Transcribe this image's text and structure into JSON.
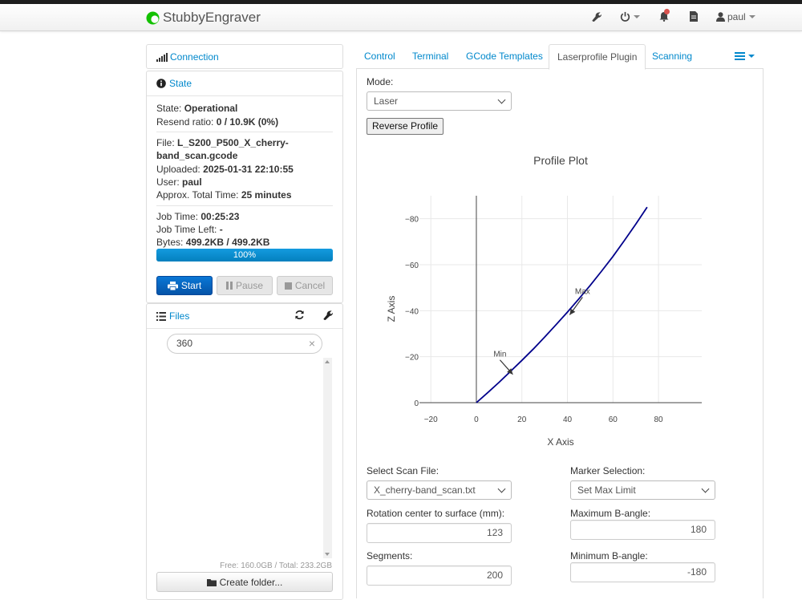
{
  "app": {
    "title": "StubbyEngraver",
    "user": "paul"
  },
  "sidebar": {
    "connection_label": "Connection",
    "state_label": "State",
    "state": {
      "state_key": "State:",
      "state_val": "Operational",
      "resend_key": "Resend ratio:",
      "resend_val": "0 / 10.9K (0%)",
      "file_key": "File:",
      "file_line1": "L_S200_P500_X_cherry-",
      "file_line2": "band_scan.gcode",
      "uploaded_key": "Uploaded:",
      "uploaded_val": "2025-01-31 22:10:55",
      "user_key": "User:",
      "user_val": "paul",
      "approx_key": "Approx. Total Time:",
      "approx_val": "25 minutes",
      "jobtime_key": "Job Time:",
      "jobtime_val": "00:25:23",
      "jobleft_key": "Job Time Left:",
      "jobleft_val": "-",
      "bytes_key": "Bytes:",
      "bytes_val": "499.2KB / 499.2KB",
      "progress_text": "100%",
      "progress_fraction": 1.0
    },
    "buttons": {
      "start": "Start",
      "pause": "Pause",
      "cancel": "Cancel"
    },
    "files": {
      "label": "Files",
      "search_value": "360",
      "free_text": "Free: 160.0GB / Total: 233.2GB",
      "create_folder": "Create folder..."
    }
  },
  "tabs": [
    "Control",
    "Terminal",
    "GCode Templates",
    "Laserprofile Plugin",
    "Scanning"
  ],
  "active_tab": "Laserprofile Plugin",
  "plugin": {
    "mode_label": "Mode:",
    "mode_value": "Laser",
    "reverse_button": "Reverse Profile",
    "scan_file_label": "Select Scan File:",
    "scan_file_value": "X_cherry-band_scan.txt",
    "marker_label": "Marker Selection:",
    "marker_value": "Set Max Limit",
    "rotation_label": "Rotation center to surface (mm):",
    "rotation_value": "123",
    "max_b_label": "Maximum B-angle:",
    "max_b_value": "180",
    "segments_label": "Segments:",
    "segments_value": "200",
    "min_b_label": "Minimum B-angle:",
    "min_b_value": "-180"
  },
  "chart_data": {
    "type": "line",
    "title": "Profile Plot",
    "xlabel": "X Axis",
    "ylabel": "Z Axis",
    "xlim": [
      -25,
      99
    ],
    "ylim": [
      0,
      -90
    ],
    "y_reversed": true,
    "x_ticks": [
      -20,
      0,
      20,
      40,
      60,
      80
    ],
    "y_ticks": [
      0,
      -20,
      -40,
      -60,
      -80
    ],
    "x_tick_labels": [
      "−20",
      "0",
      "20",
      "40",
      "60",
      "80"
    ],
    "y_tick_labels": [
      "0",
      "−20",
      "−40",
      "−60",
      "−80"
    ],
    "grid": true,
    "line_color": "#00008b",
    "series": [
      {
        "x": [
          0,
          5,
          10,
          15,
          20,
          25,
          30,
          35,
          40,
          45,
          50,
          55,
          60,
          65,
          70,
          75
        ],
        "y": [
          0,
          -4.4,
          -8.9,
          -13.6,
          -18.4,
          -23.3,
          -28.5,
          -33.9,
          -39.4,
          -45.1,
          -51.0,
          -57.2,
          -63.6,
          -70.5,
          -77.6,
          -85.0
        ]
      }
    ],
    "annotations": [
      {
        "text": "Min",
        "x": 16,
        "y": -12.3
      },
      {
        "text": "Max",
        "x": 41,
        "y": -38.2
      }
    ]
  }
}
